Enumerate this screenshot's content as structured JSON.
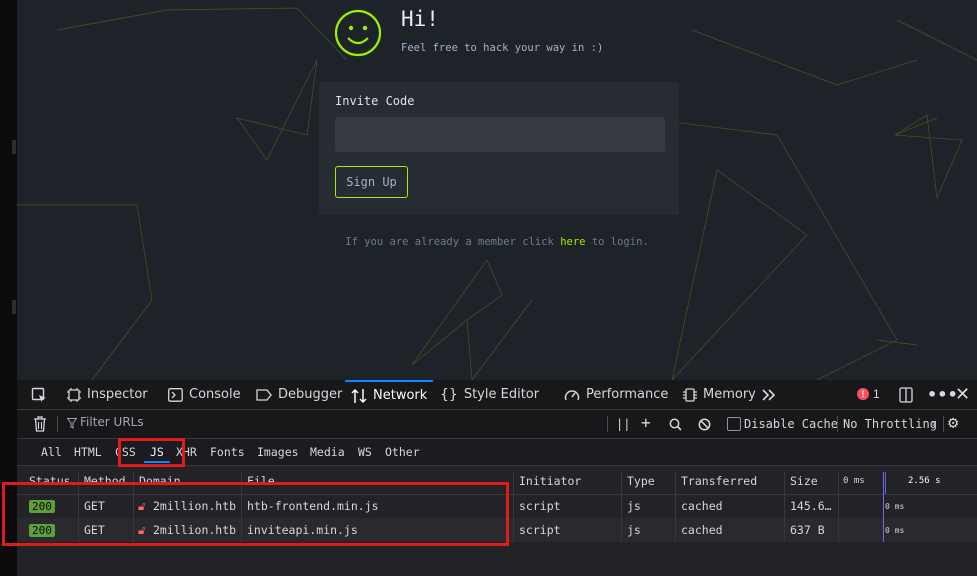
{
  "page": {
    "title": "Hi!",
    "tagline": "Feel free to hack your way in :)",
    "invite_label": "Invite Code",
    "invite_value": "",
    "signup_button": "Sign Up",
    "login_prefix": "If you are already a member click ",
    "login_link": "here",
    "login_suffix": " to login."
  },
  "devtools": {
    "tools": [
      "Inspector",
      "Console",
      "Debugger",
      "Network",
      "Style Editor",
      "Performance",
      "Memory"
    ],
    "active_tool": "Network",
    "error_count": "1",
    "filter_placeholder": "Filter URLs",
    "disable_cache_label": "Disable Cache",
    "throttling": "No Throttling",
    "type_filters": [
      "All",
      "HTML",
      "CSS",
      "JS",
      "XHR",
      "Fonts",
      "Images",
      "Media",
      "WS",
      "Other"
    ],
    "active_type": "JS",
    "columns": [
      "Status",
      "Method",
      "Domain",
      "File",
      "Initiator",
      "Type",
      "Transferred",
      "Size",
      "0 ms",
      "2.56 s"
    ],
    "rows": [
      {
        "status": "200",
        "method": "GET",
        "domain": "2million.htb",
        "file": "htb-frontend.min.js",
        "initiator": "script",
        "type": "js",
        "transferred": "cached",
        "size": "145.6…",
        "timing": "0 ms"
      },
      {
        "status": "200",
        "method": "GET",
        "domain": "2million.htb",
        "file": "inviteapi.min.js",
        "initiator": "script",
        "type": "js",
        "transferred": "cached",
        "size": "637 B",
        "timing": "0 ms"
      }
    ]
  },
  "colors": {
    "accent_green": "#9fef00",
    "annotation_red": "#e01b1b",
    "devtools_active_blue": "#0a84ff"
  }
}
